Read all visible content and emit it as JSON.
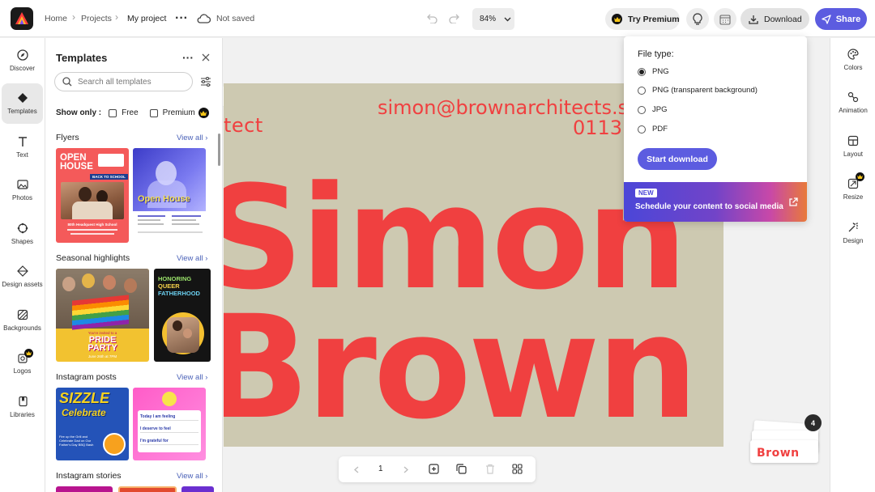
{
  "header": {
    "breadcrumb": [
      "Home",
      "Projects",
      "My project"
    ],
    "save_status": "Not saved",
    "zoom": "84%",
    "try_premium": "Try Premium",
    "download": "Download",
    "share": "Share"
  },
  "left_rail": {
    "items": [
      {
        "label": "Discover",
        "icon": "compass-icon"
      },
      {
        "label": "Templates",
        "icon": "templates-icon",
        "active": true
      },
      {
        "label": "Text",
        "icon": "text-icon"
      },
      {
        "label": "Photos",
        "icon": "photo-icon"
      },
      {
        "label": "Shapes",
        "icon": "shapes-icon"
      },
      {
        "label": "Design assets",
        "icon": "design-assets-icon"
      },
      {
        "label": "Backgrounds",
        "icon": "backgrounds-icon"
      },
      {
        "label": "Logos",
        "icon": "logos-icon"
      },
      {
        "label": "Libraries",
        "icon": "libraries-icon"
      }
    ]
  },
  "templates_panel": {
    "title": "Templates",
    "search_placeholder": "Search all templates",
    "show_only": "Show only :",
    "free": "Free",
    "premium": "Premium",
    "view_all": "View all",
    "sections": [
      "Flyers",
      "Seasonal highlights",
      "Instagram posts",
      "Instagram stories"
    ],
    "thumbs": {
      "flyer1": {
        "line1": "OPEN",
        "line2": "HOUSE",
        "sub": "BACK TO SCHOOL",
        "foot": "80th Headquest High School"
      },
      "flyer2": {
        "title": "Open House"
      },
      "season1": {
        "line1": "You're invited to a",
        "line2": "PRIDE",
        "line3": "PARTY",
        "sub": "June 26th at 7PM"
      },
      "season2": {
        "line1": "HONORING",
        "line2": "QUEER",
        "line3": "FATHERHOOD"
      },
      "insta1": {
        "line1": "SIZZLE",
        "line2": "Celebrate",
        "sub": "Fire up the Grill and Celebrate Dad on Our Father's Day BBQ Bash"
      },
      "insta2": {
        "line1": "Today I am feeling",
        "line2": "I deserve to feel",
        "line3": "I'm grateful for"
      }
    }
  },
  "canvas": {
    "email": "simon@brownarchitects.s",
    "phone": "0113 4",
    "fragment": "tect",
    "name1": "Simon",
    "name2": "Brown",
    "bg_color": "#cdc9b1",
    "text_color": "#f04040"
  },
  "download_menu": {
    "title": "File type:",
    "options": [
      "PNG",
      "PNG (transparent background)",
      "JPG",
      "PDF"
    ],
    "selected": 0,
    "start": "Start download",
    "new_badge": "NEW",
    "promo": "Schedule your content to social media"
  },
  "right_rail": {
    "items": [
      {
        "label": "Colors",
        "icon": "palette-icon"
      },
      {
        "label": "Animation",
        "icon": "animation-icon"
      },
      {
        "label": "Layout",
        "icon": "layout-icon"
      },
      {
        "label": "Resize",
        "icon": "resize-icon"
      },
      {
        "label": "Design",
        "icon": "design-icon"
      }
    ]
  },
  "bottom_bar": {
    "page": "1"
  },
  "pages_stack": {
    "count": "4",
    "thumb_text": "Brown"
  },
  "colors": {
    "accent": "#5c5ce0",
    "canvas_bg": "#cdc9b1",
    "canvas_text": "#f04040"
  }
}
